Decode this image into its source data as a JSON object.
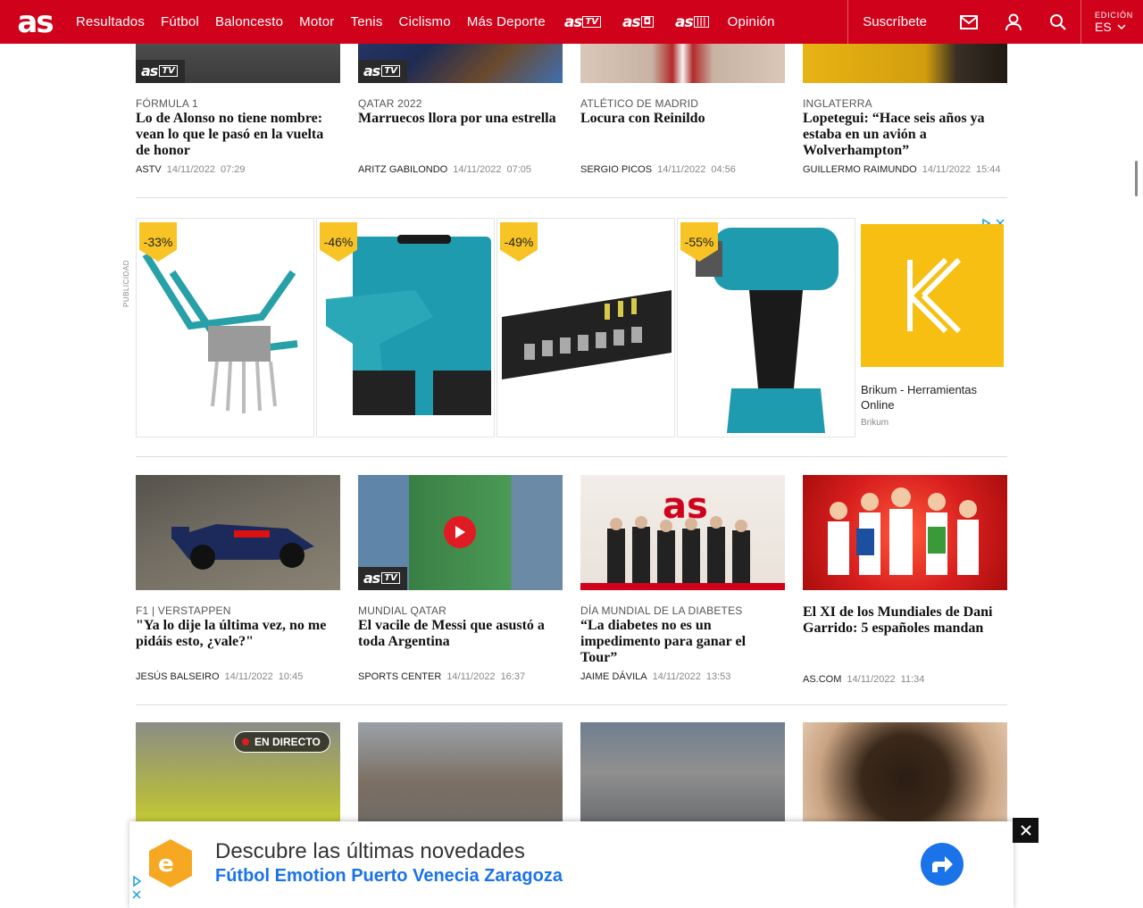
{
  "header": {
    "logo": "as",
    "nav": [
      "Resultados",
      "Fútbol",
      "Baloncesto",
      "Motor",
      "Tenis",
      "Ciclismo",
      "Más Deporte"
    ],
    "brands": [
      {
        "word": "as",
        "tag": "TV"
      },
      {
        "word": "as",
        "tag": "◘"
      },
      {
        "word": "as",
        "tag": "|||"
      }
    ],
    "opinion": "Opinión",
    "subscribe": "Suscríbete",
    "edition_label": "EDICIÓN",
    "edition_value": "ES"
  },
  "astv_badge": {
    "word": "as",
    "tag": "TV"
  },
  "row1": [
    {
      "kicker": "FÓRMULA 1",
      "headline": "Lo de Alonso no tiene nombre: vean lo que le pasó en la vuelta de honor",
      "author": "ASTV",
      "date": "14/11/2022",
      "time": "07:29"
    },
    {
      "kicker": "QATAR 2022",
      "headline": "Marruecos llora por una estrella",
      "author": "ARITZ GABILONDO",
      "date": "14/11/2022",
      "time": "07:05"
    },
    {
      "kicker": "ATLÉTICO DE MADRID",
      "headline": "Locura con Reinildo",
      "author": "SERGIO PICOS",
      "date": "14/11/2022",
      "time": "04:56"
    },
    {
      "kicker": "INGLATERRA",
      "headline": "Lopetegui: “Hace seis años ya estaba en un avión a Wolverhampton”",
      "author": "GUILLERMO RAIMUNDO",
      "date": "14/11/2022",
      "time": "15:44"
    }
  ],
  "ad": {
    "label": "PUBLICIDAD",
    "discounts": [
      "-33%",
      "-46%",
      "-49%",
      "-55%"
    ],
    "brikum_title": "Brikum - Herramientas Online",
    "brikum_source": "Brikum"
  },
  "row2": [
    {
      "kicker": "F1 | VERSTAPPEN",
      "headline": "\"Ya lo dije la última vez, no me pidáis esto, ¿vale?\"",
      "author": "JESÚS BALSEIRO",
      "date": "14/11/2022",
      "time": "10:45"
    },
    {
      "kicker": "MUNDIAL QATAR",
      "headline": "El vacile de Messi que asustó a toda Argentina",
      "author": "SPORTS CENTER",
      "date": "14/11/2022",
      "time": "16:37"
    },
    {
      "kicker": "DÍA MUNDIAL DE LA DIABETES",
      "headline": "“La diabetes no es un impedimento para ganar el Tour”",
      "author": "JAIME DÁVILA",
      "date": "14/11/2022",
      "time": "13:53"
    },
    {
      "kicker": "",
      "headline": "El XI de los Mundiales de Dani Garrido: 5 españoles mandan",
      "author": "AS.COM",
      "date": "14/11/2022",
      "time": "11:34"
    }
  ],
  "row3": {
    "live_label": "EN DIRECTO"
  },
  "banner": {
    "title": "Descubre las últimas novedades",
    "subtitle": "Fútbol Emotion Puerto Venecia Zaragoza"
  }
}
